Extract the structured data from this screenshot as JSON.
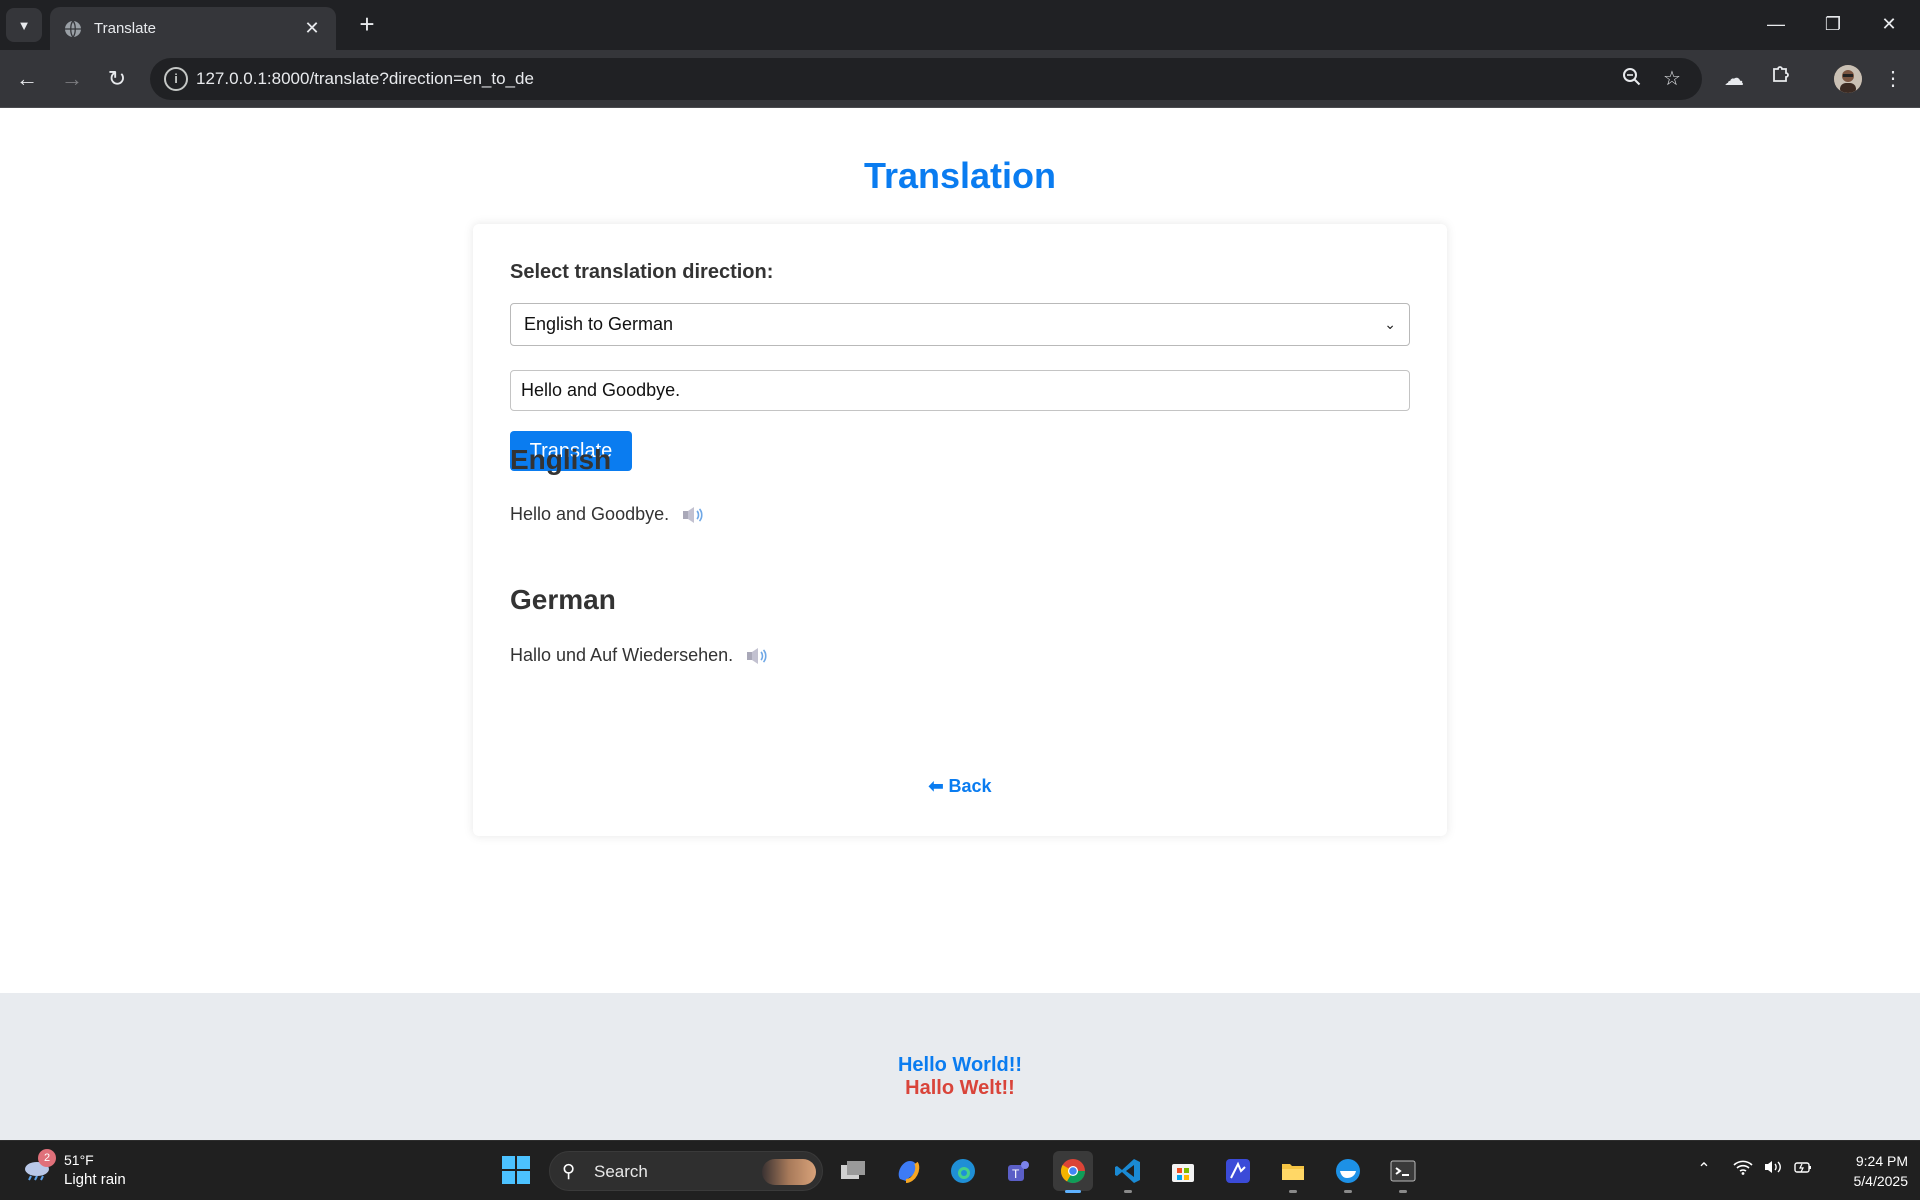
{
  "browser": {
    "tab_title": "Translate",
    "url": "127.0.0.1:8000/translate?direction=en_to_de"
  },
  "page": {
    "title": "Translation",
    "direction_label": "Select translation direction:",
    "direction_selected": "English to German",
    "input_value": "Hello and Goodbye.",
    "translate_label": "Translate",
    "source_heading": "English",
    "source_text": "Hello and Goodbye.",
    "target_heading": "German",
    "target_text": "Hallo und Auf Wiedersehen.",
    "back_label": "⬅ Back"
  },
  "footer": {
    "line1": "Hello World!!",
    "line2": "Hallo Welt!!"
  },
  "taskbar": {
    "weather_badge": "2",
    "weather_temp": "51°F",
    "weather_desc": "Light rain",
    "search_label": "Search",
    "time": "9:24 PM",
    "date": "5/4/2025"
  },
  "colors": {
    "accent": "#0a7cf0",
    "footer_red": "#d9443a",
    "footer_bg": "#e8ebef"
  }
}
